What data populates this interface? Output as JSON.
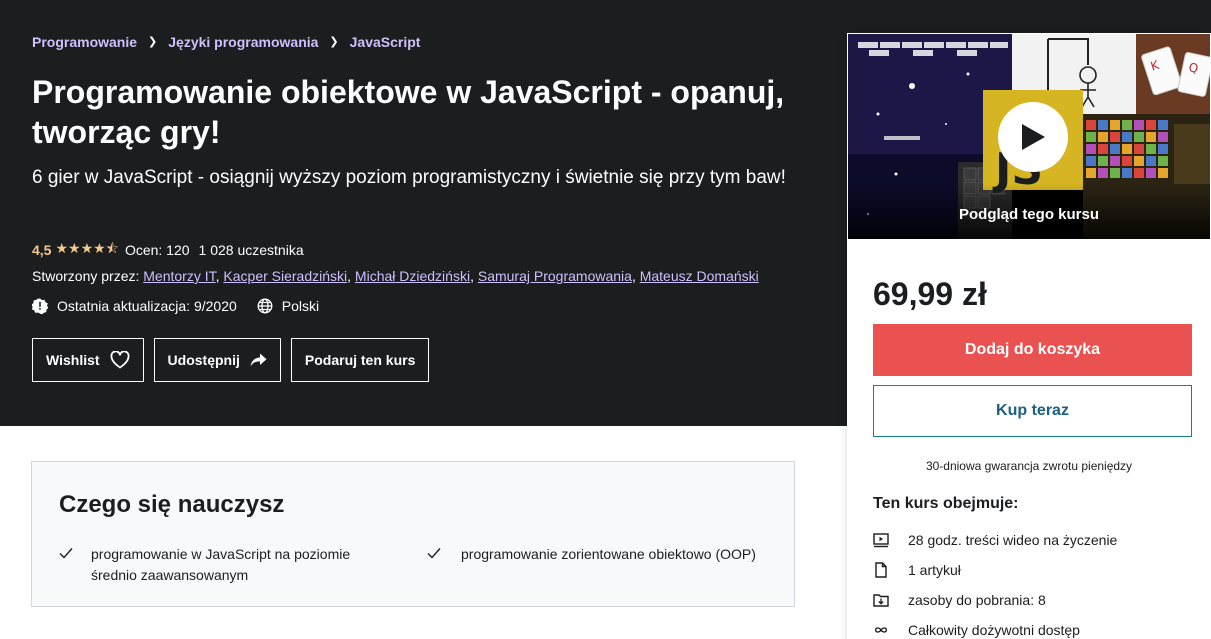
{
  "breadcrumb": [
    "Programowanie",
    "Języki programowania",
    "JavaScript"
  ],
  "course": {
    "title": "Programowanie obiektowe w JavaScript - opanuj, tworząc gry!",
    "subtitle": "6 gier w JavaScript - osiągnij wyższy poziom programistyczny i świetnie się przy tym baw!",
    "rating_value": "4,5",
    "stars_value": 4.5,
    "ratings_label": "Ocen: 120",
    "students_label": "1 028 uczestnika",
    "created_by_label": "Stworzony przez:",
    "creators": [
      "Mentorzy IT",
      "Kacper Sieradziński",
      "Michał Dziedziński",
      "Samuraj Programowania",
      "Mateusz Domański"
    ],
    "last_updated": "Ostatnia aktualizacja: 9/2020",
    "language": "Polski"
  },
  "actions": {
    "wishlist": "Wishlist",
    "share": "Udostępnij",
    "gift": "Podaruj ten kurs"
  },
  "sidebar": {
    "preview_label": "Podgląd tego kursu",
    "price": "69,99 zł",
    "add_to_cart": "Dodaj do koszyka",
    "buy_now": "Kup teraz",
    "guarantee": "30-dniowa gwarancja zwrotu pieniędzy",
    "includes_title": "Ten kurs obejmuje:",
    "includes": [
      {
        "icon": "video-icon",
        "text": "28 godz. treści wideo na życzenie"
      },
      {
        "icon": "file-icon",
        "text": "1 artykuł"
      },
      {
        "icon": "download-icon",
        "text": "zasoby do pobrania: 8"
      },
      {
        "icon": "infinity-icon",
        "text": "Całkowity dożywotni dostęp"
      }
    ]
  },
  "learn": {
    "title": "Czego się nauczysz",
    "items": [
      "programowanie w JavaScript na poziomie średnio zaawansowanym",
      "programowanie zorientowane obiektowo (OOP)"
    ]
  },
  "colors": {
    "hero_bg": "#1c1d1f",
    "link_purple": "#cec0fc",
    "star_gold": "#f3ca8c",
    "cart_red": "#ea5252"
  }
}
